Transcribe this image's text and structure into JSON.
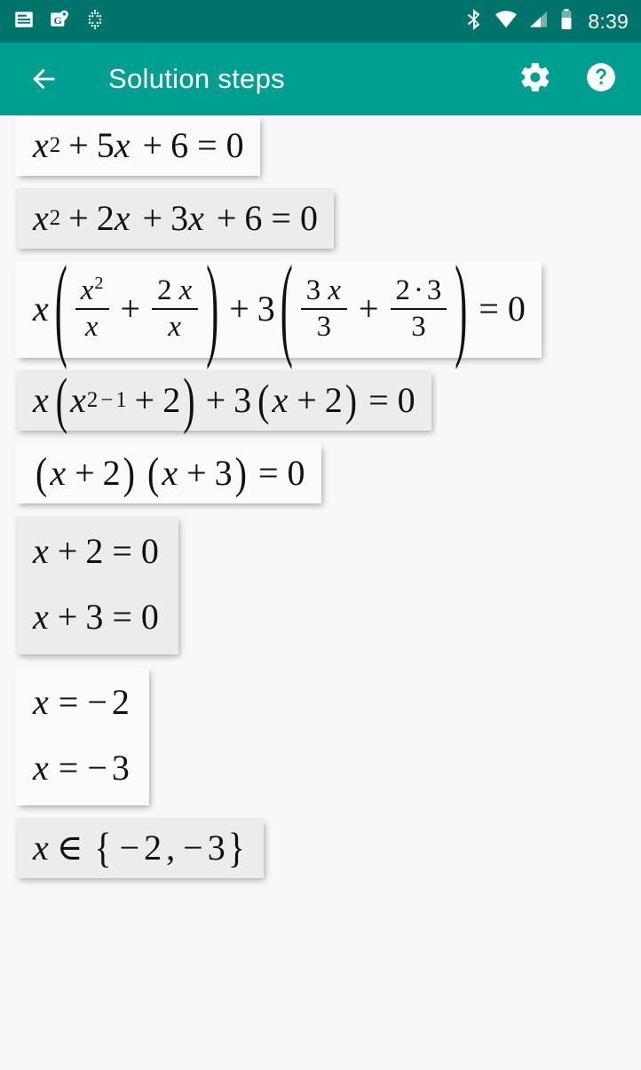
{
  "status_bar": {
    "time": "8:39",
    "icons_left": [
      "news-article-icon",
      "google-maps-pin-icon",
      "fitness-dots-icon"
    ],
    "icons_right": [
      "bluetooth-icon",
      "wifi-icon",
      "cellular-signal-icon",
      "battery-icon"
    ],
    "background_color": "#00736a"
  },
  "app_bar": {
    "back_label": "←",
    "title": "Solution steps",
    "settings_icon": "gear-icon",
    "help_icon": "help-circle-icon",
    "background_color": "#009d91",
    "text_color": "#ffffff"
  },
  "steps": [
    {
      "index": 1,
      "shade": "light",
      "text": "x^2 + 5 x + 6 = 0",
      "parts": {
        "x": "x",
        "exp2": "2",
        "plus": "+",
        "five": "5",
        "six": "6",
        "eq": "=",
        "zero": "0"
      }
    },
    {
      "index": 2,
      "shade": "dark",
      "text": "x^2 + 2 x + 3 x + 6 = 0",
      "parts": {
        "x": "x",
        "exp2": "2",
        "plus": "+",
        "two": "2",
        "three": "3",
        "six": "6",
        "eq": "=",
        "zero": "0"
      }
    },
    {
      "index": 3,
      "shade": "light",
      "text": "x ( x^2/x + 2x/x ) + 3 ( 3x/3 + 2·3/3 ) = 0",
      "parts": {
        "x": "x",
        "exp2": "2",
        "plus": "+",
        "two": "2",
        "three": "3",
        "dot": "·",
        "eq": "=",
        "zero": "0",
        "lparen": "(",
        "rparen": ")"
      }
    },
    {
      "index": 4,
      "shade": "dark",
      "text": "x ( x^(2 - 1) + 2 ) + 3 ( x + 2 ) = 0",
      "parts": {
        "x": "x",
        "exp2": "2",
        "minus": "−",
        "one": "1",
        "plus": "+",
        "two": "2",
        "three": "3",
        "eq": "=",
        "zero": "0",
        "lparen": "(",
        "rparen": ")"
      }
    },
    {
      "index": 5,
      "shade": "light",
      "text": "( x + 2 ) ( x + 3 ) = 0",
      "parts": {
        "x": "x",
        "plus": "+",
        "two": "2",
        "three": "3",
        "eq": "=",
        "zero": "0",
        "lparen": "(",
        "rparen": ")"
      }
    },
    {
      "index": 6,
      "shade": "dark",
      "lines": [
        "x + 2 = 0",
        "x + 3 = 0"
      ],
      "parts": {
        "x": "x",
        "plus": "+",
        "two": "2",
        "three": "3",
        "eq": "=",
        "zero": "0"
      }
    },
    {
      "index": 7,
      "shade": "light",
      "lines": [
        "x = − 2",
        "x = − 3"
      ],
      "parts": {
        "x": "x",
        "eq": "=",
        "minus": "−",
        "two": "2",
        "three": "3"
      }
    },
    {
      "index": 8,
      "shade": "dark",
      "text": "x ∈ { − 2 , − 3 }",
      "parts": {
        "x": "x",
        "elem": "∈",
        "lbrace": "{",
        "rbrace": "}",
        "minus": "−",
        "two": "2",
        "three": "3",
        "comma": ","
      }
    }
  ],
  "theme": {
    "page_background": "#f8f8f8",
    "card_light": "#fbfbfb",
    "card_dark": "#ececec",
    "math_color": "#111111"
  }
}
